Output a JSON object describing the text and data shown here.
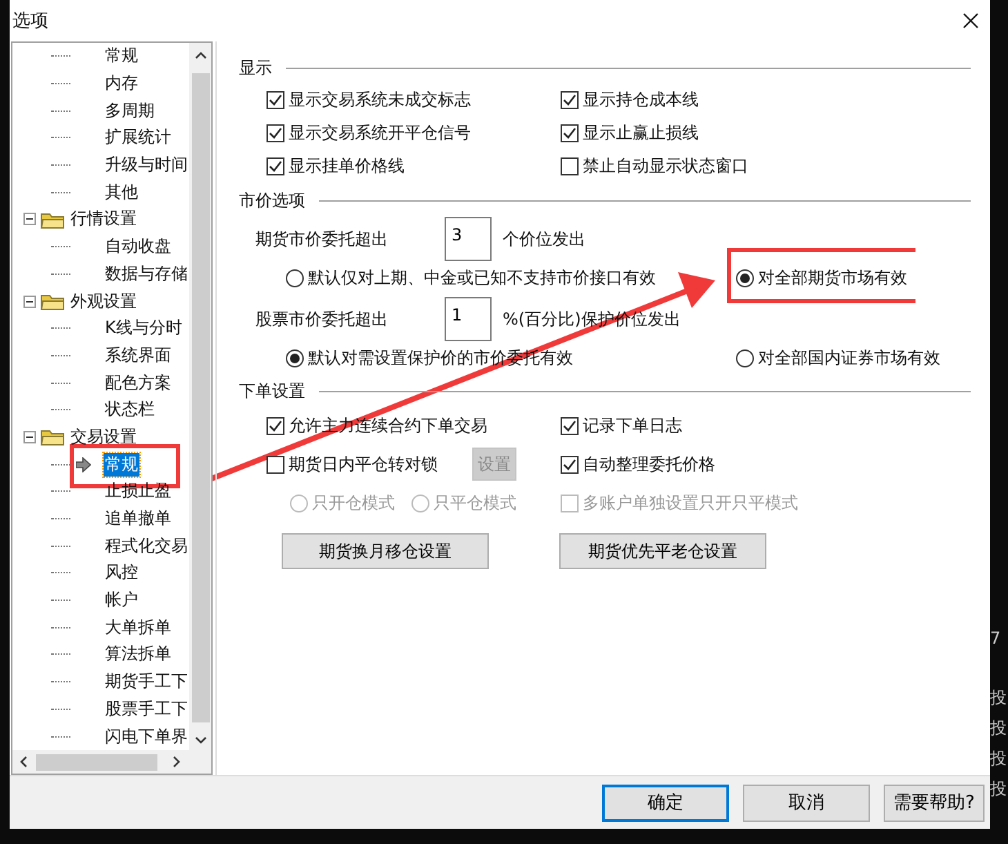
{
  "window": {
    "title": "选项"
  },
  "tree": [
    {
      "children": [
        {
          "label": "常规",
          "selected": false
        },
        {
          "label": "内存",
          "selected": false
        },
        {
          "label": "多周期",
          "selected": false
        },
        {
          "label": "扩展统计",
          "selected": false
        },
        {
          "label": "升级与时间",
          "selected": false
        },
        {
          "label": "其他",
          "selected": false
        }
      ]
    },
    {
      "label": "行情设置",
      "expanded": true,
      "children": [
        {
          "label": "自动收盘",
          "selected": false
        },
        {
          "label": "数据与存储",
          "selected": false
        }
      ]
    },
    {
      "label": "外观设置",
      "expanded": true,
      "children": [
        {
          "label": "K线与分时",
          "selected": false
        },
        {
          "label": "系统界面",
          "selected": false
        },
        {
          "label": "配色方案",
          "selected": false
        },
        {
          "label": "状态栏",
          "selected": false
        }
      ]
    },
    {
      "label": "交易设置",
      "expanded": true,
      "children": [
        {
          "label": "常规",
          "selected": true
        },
        {
          "label": "止损止盈",
          "selected": false
        },
        {
          "label": "追单撤单",
          "selected": false
        },
        {
          "label": "程式化交易",
          "selected": false
        },
        {
          "label": "风控",
          "selected": false
        },
        {
          "label": "帐户",
          "selected": false
        },
        {
          "label": "大单拆单",
          "selected": false
        },
        {
          "label": "算法拆单",
          "selected": false
        },
        {
          "label": "期货手工下",
          "selected": false
        },
        {
          "label": "股票手工下",
          "selected": false
        },
        {
          "label": "闪电下单界",
          "selected": false
        }
      ]
    }
  ],
  "display": {
    "title": "显示",
    "checkboxes": [
      {
        "label": "显示交易系统未成交标志",
        "checked": true
      },
      {
        "label": "显示持仓成本线",
        "checked": true
      },
      {
        "label": "显示交易系统开平仓信号",
        "checked": true
      },
      {
        "label": "显示止赢止损线",
        "checked": true
      },
      {
        "label": "显示挂单价格线",
        "checked": true
      },
      {
        "label": "禁止自动显示状态窗口",
        "checked": false
      }
    ]
  },
  "market": {
    "title": "市价选项",
    "groups": [
      {
        "label": "期货市价委托超出",
        "value": "3",
        "suffix": "个价位发出",
        "options": [
          {
            "label": "默认仅对上期、中金或已知不支持市价接口有效",
            "selected": false
          },
          {
            "label": "对全部期货市场有效",
            "selected": true
          }
        ]
      },
      {
        "label": "股票市价委托超出",
        "value": "1",
        "suffix": "%(百分比)保护价位发出",
        "options": [
          {
            "label": "默认对需设置保护价的市价委托有效",
            "selected": true
          },
          {
            "label": "对全部国内证券市场有效",
            "selected": false
          }
        ]
      }
    ]
  },
  "order": {
    "title": "下单设置",
    "rows": [
      {
        "left": [
          {
            "kind": "checkbox",
            "label": "允许主力连续合约下单交易",
            "checked": true,
            "disabled": false
          }
        ],
        "right": {
          "kind": "checkbox",
          "label": "记录下单日志",
          "checked": true,
          "disabled": false
        }
      },
      {
        "left": [
          {
            "kind": "checkbox",
            "label": "期货日内平仓转对锁",
            "checked": false,
            "disabled": false
          },
          {
            "kind": "button",
            "label": "设置",
            "disabled": true
          }
        ],
        "right": {
          "kind": "checkbox",
          "label": "自动整理委托价格",
          "checked": true,
          "disabled": false
        }
      },
      {
        "left": [
          {
            "kind": "radio",
            "label": "只开仓模式",
            "selected": false,
            "disabled": true
          },
          {
            "kind": "radio",
            "label": "只平仓模式",
            "selected": false,
            "disabled": true
          }
        ],
        "right": {
          "kind": "checkbox",
          "label": "多账户单独设置只开只平模式",
          "checked": false,
          "disabled": true
        }
      }
    ],
    "buttons": [
      "期货换月移仓设置",
      "期货优先平老仓设置"
    ]
  },
  "footer": [
    {
      "label": "确定",
      "focused": true
    },
    {
      "label": "取消",
      "focused": false
    },
    {
      "label": "需要帮助?",
      "focused": false
    }
  ],
  "background_app": {
    "labels": [
      "7",
      "投",
      "投",
      "投",
      "投"
    ]
  }
}
